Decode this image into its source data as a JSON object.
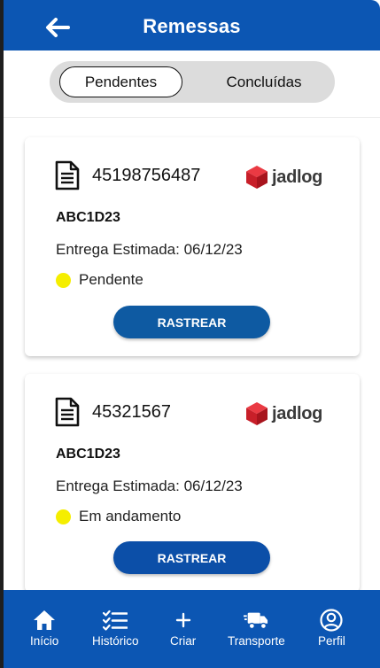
{
  "header": {
    "title": "Remessas",
    "back_icon": "arrow-left-icon"
  },
  "tabs": [
    {
      "label": "Pendentes",
      "active": true
    },
    {
      "label": "Concluídas",
      "active": false
    }
  ],
  "shipments": [
    {
      "tracking": "45198756487",
      "carrier": "jadlog",
      "code": "ABC1D23",
      "estimate": "Entrega Estimada: 06/12/23",
      "status": "Pendente",
      "status_color": "#f5ee00",
      "button_label": "RASTREAR"
    },
    {
      "tracking": "45321567",
      "carrier": "jadlog",
      "code": "ABC1D23",
      "estimate": "Entrega Estimada: 06/12/23",
      "status": "Em andamento",
      "status_color": "#f5ee00",
      "button_label": "RASTREAR"
    }
  ],
  "nav": [
    {
      "label": "Início",
      "icon": "home-icon"
    },
    {
      "label": "Histórico",
      "icon": "checklist-icon"
    },
    {
      "label": "Criar",
      "icon": "plus-icon"
    },
    {
      "label": "Transporte",
      "icon": "truck-icon"
    },
    {
      "label": "Perfil",
      "icon": "user-circle-icon"
    }
  ],
  "colors": {
    "primary": "#0c56b3",
    "button": "#0e5aa2",
    "carrier_red": "#d6202a"
  }
}
